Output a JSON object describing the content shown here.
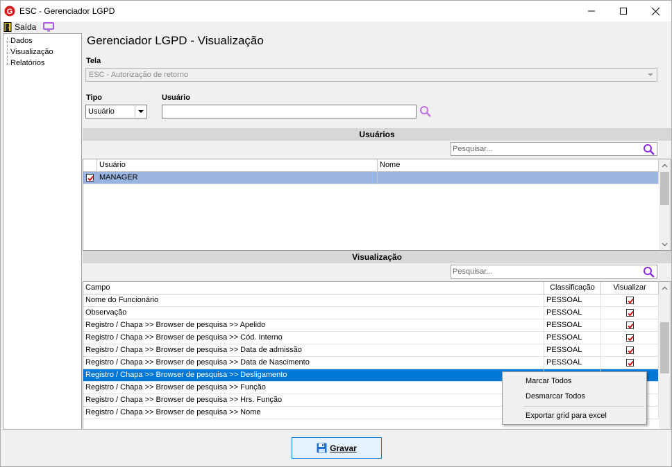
{
  "window": {
    "title": "ESC - Gerenciador LGPD"
  },
  "menu": {
    "exit_label": "Saída"
  },
  "tree": {
    "items": [
      "Dados",
      "Visualização",
      "Relatórios"
    ]
  },
  "page": {
    "title": "Gerenciador LGPD - Visualização"
  },
  "form": {
    "tela_label": "Tela",
    "tela_value": "ESC - Autorização de retorno",
    "tipo_label": "Tipo",
    "tipo_value": "Usuário",
    "usuario_label": "Usuário",
    "usuario_value": ""
  },
  "usuarios_section": {
    "title": "Usuários",
    "search_placeholder": "Pesquisar...",
    "columns": [
      "Usuário",
      "Nome"
    ],
    "rows": [
      {
        "usuario": "MANAGER",
        "nome": "",
        "checked": true
      }
    ]
  },
  "visualizacao_section": {
    "title": "Visualização",
    "search_placeholder": "Pesquisar...",
    "columns": [
      "Campo",
      "Classificação",
      "Visualizar"
    ],
    "rows": [
      {
        "campo": "Nome do Funcionário",
        "classificacao": "PESSOAL",
        "visualizar": true
      },
      {
        "campo": "Observação",
        "classificacao": "PESSOAL",
        "visualizar": true
      },
      {
        "campo": "Registro / Chapa >> Browser de pesquisa >> Apelido",
        "classificacao": "PESSOAL",
        "visualizar": true
      },
      {
        "campo": "Registro / Chapa >> Browser de pesquisa >> Cód. Interno",
        "classificacao": "PESSOAL",
        "visualizar": true
      },
      {
        "campo": "Registro / Chapa >> Browser de pesquisa >> Data de admissão",
        "classificacao": "PESSOAL",
        "visualizar": true
      },
      {
        "campo": "Registro / Chapa >> Browser de pesquisa >> Data de Nascimento",
        "classificacao": "PESSOAL",
        "visualizar": true
      },
      {
        "campo": "Registro / Chapa >> Browser de pesquisa >> Desligamento",
        "classificacao": "",
        "visualizar": null,
        "selected": true
      },
      {
        "campo": "Registro / Chapa >> Browser de pesquisa >> Função",
        "classificacao": "",
        "visualizar": null
      },
      {
        "campo": "Registro / Chapa >> Browser de pesquisa >> Hrs. Função",
        "classificacao": "",
        "visualizar": null
      },
      {
        "campo": "Registro / Chapa >> Browser de pesquisa >> Nome",
        "classificacao": "",
        "visualizar": null
      }
    ]
  },
  "context_menu": {
    "items": [
      "Marcar Todos",
      "Desmarcar Todos",
      "Exportar grid para excel"
    ]
  },
  "buttons": {
    "save_label": "Gravar"
  },
  "colors": {
    "selection": "#0078d7",
    "user_row_selected": "#99b4e0",
    "check_red": "#d00000",
    "search_purple": "#8a2be2"
  }
}
